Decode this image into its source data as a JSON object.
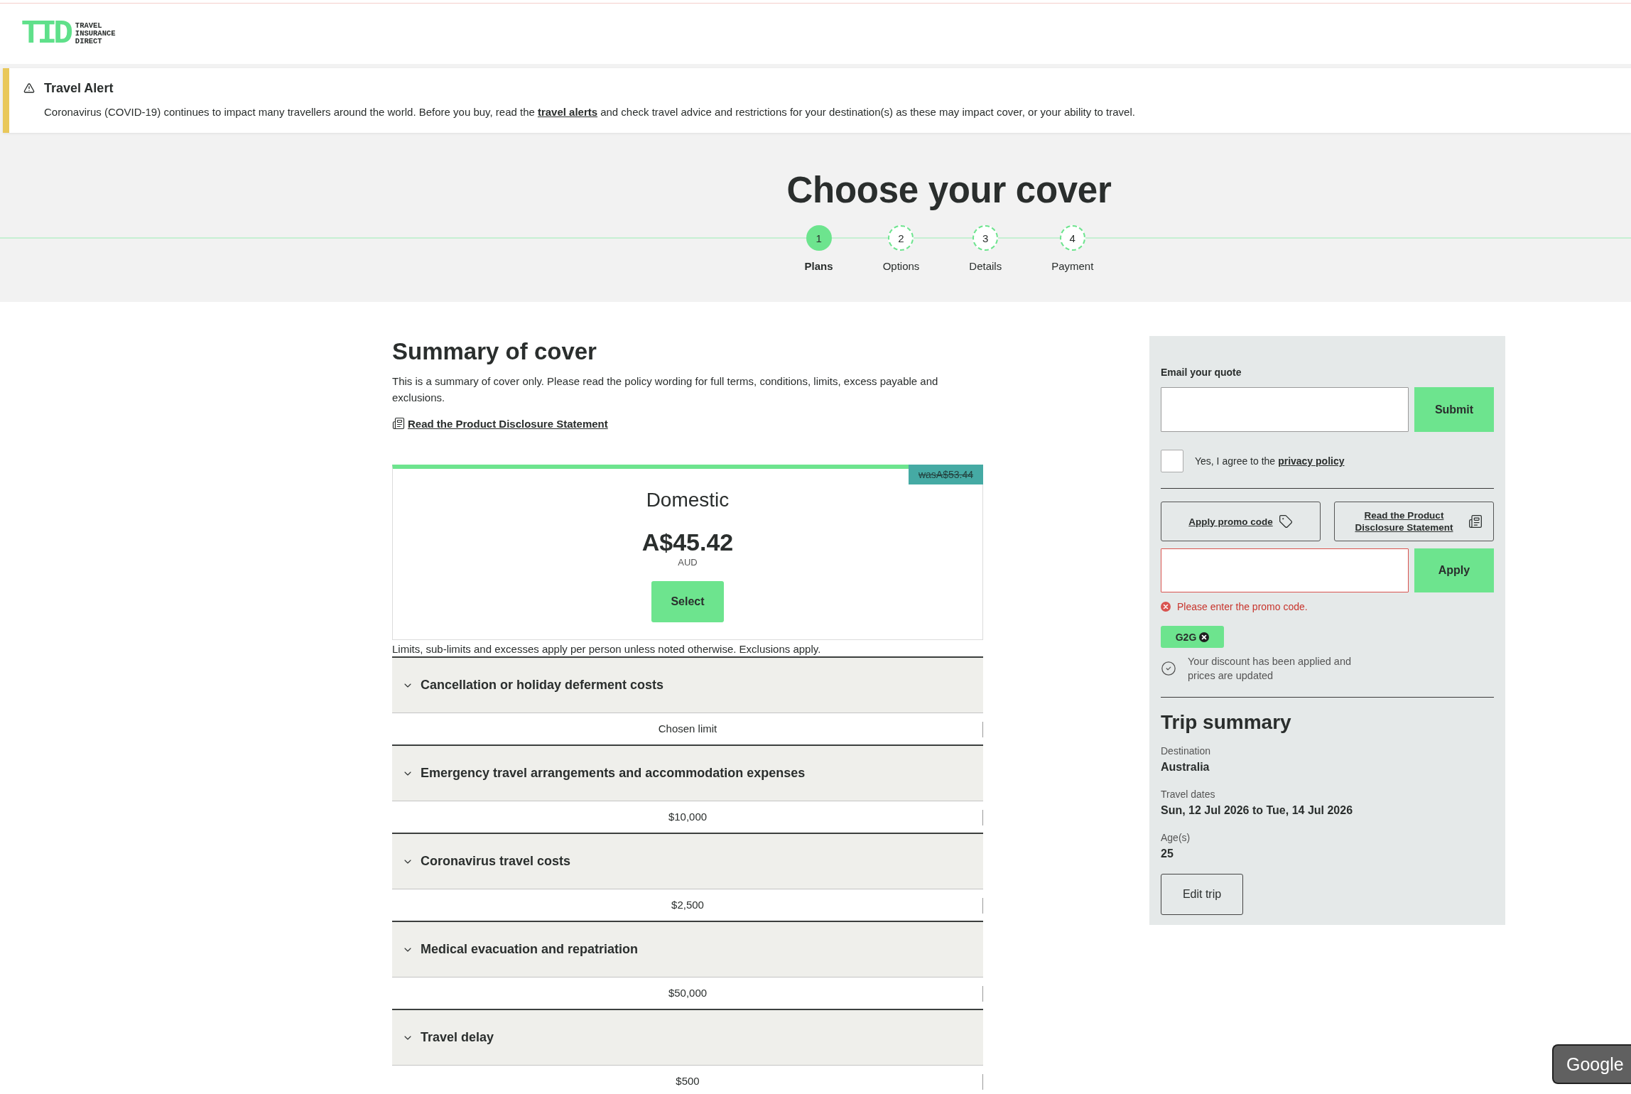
{
  "logo": {
    "mark": "TID",
    "tagline": [
      "TRAVEL",
      "INSURANCE",
      "DIRECT"
    ]
  },
  "alert": {
    "title": "Travel Alert",
    "text": "Coronavirus (COVID-19) continues to impact many travellers around the world. Before you buy, read the",
    "link": "travel alerts",
    "text_after": "and check travel advice and restrictions for your destination(s) as these may impact cover, or your ability to travel."
  },
  "page_title": "Choose your cover",
  "steps": [
    {
      "number": "1",
      "label": "Plans",
      "selected": true
    },
    {
      "number": "2",
      "label": "Options",
      "selected": false
    },
    {
      "number": "3",
      "label": "Details",
      "selected": false
    },
    {
      "number": "4",
      "label": "Payment",
      "selected": false
    }
  ],
  "summary": {
    "title": "Summary of cover",
    "intro": "This is a summary of cover only. Please read the policy wording for full terms, conditions, limits, excess payable and exclusions.",
    "pds_link": "Read the Product Disclosure Statement"
  },
  "plan": {
    "old_price": "wasA$53.44",
    "name": "Domestic",
    "price": "A$45.42",
    "currency": "AUD",
    "select_button": "Select"
  },
  "limits_note": "Limits, sub-limits and excesses apply per person unless noted otherwise. Exclusions apply.",
  "benefits": [
    {
      "title": "Cancellation or holiday deferment costs",
      "value": "Chosen limit"
    },
    {
      "title": "Emergency travel arrangements and accommodation expenses",
      "value": "$10,000"
    },
    {
      "title": "Coronavirus travel costs",
      "value": "$2,500"
    },
    {
      "title": "Medical evacuation and repatriation",
      "value": "$50,000"
    },
    {
      "title": "Travel delay",
      "value": "$500"
    }
  ],
  "sidebar": {
    "email": {
      "label": "Email your quote",
      "button": "Submit"
    },
    "privacy": {
      "text": "Yes, I agree to the",
      "link": "privacy policy",
      "checked": false
    },
    "promo_button": "Apply promo code",
    "pds_button": "Read the Product Disclosure Statement",
    "promo": {
      "invalid": true,
      "button": "Apply",
      "error": "Please enter the promo code."
    },
    "applied_codes": [
      {
        "code": "G2G"
      }
    ],
    "discount_message": "Your discount has been applied and prices are updated",
    "trip": {
      "title": "Trip summary",
      "fields": [
        {
          "label": "Destination",
          "value": "Australia"
        },
        {
          "label": "Travel dates",
          "value": "Sun, 12 Jul 2026 to Tue, 14 Jul 2026"
        },
        {
          "label": "Age(s)",
          "value": "25"
        }
      ],
      "edit_button": "Edit trip"
    }
  },
  "floating_button": "Google"
}
